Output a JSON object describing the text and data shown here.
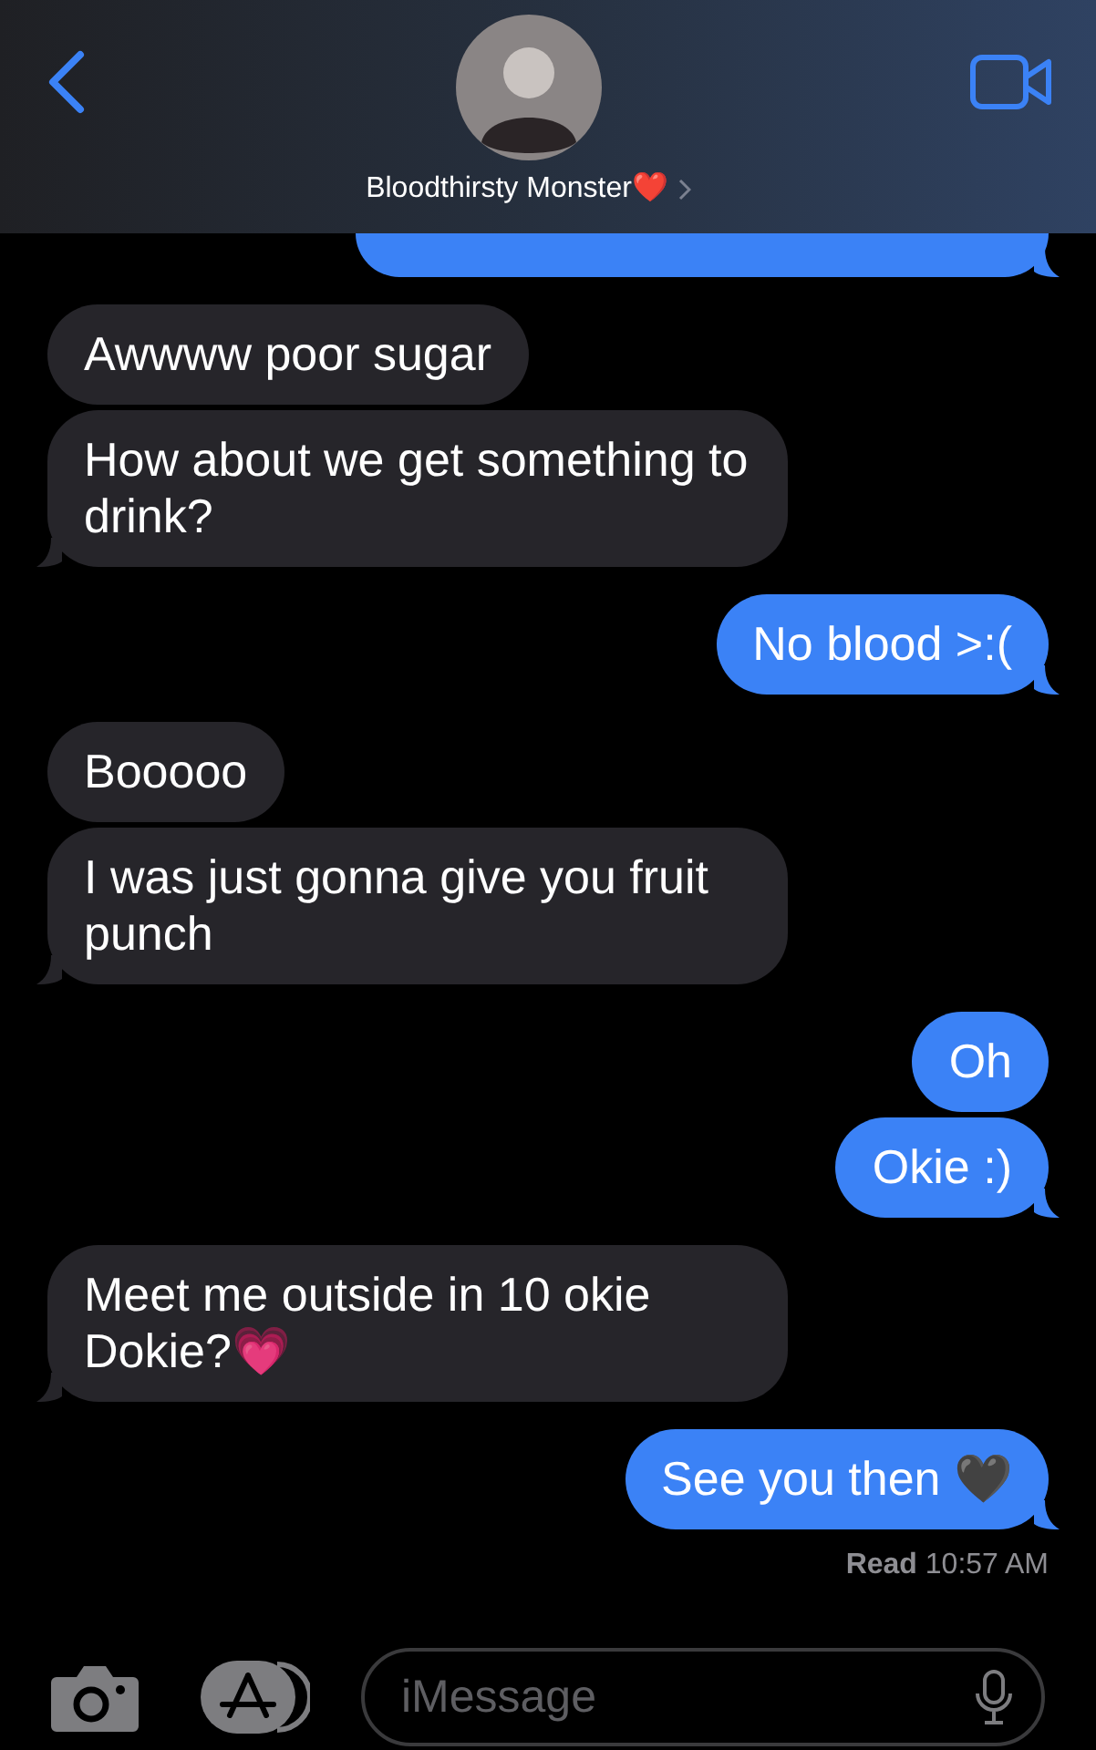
{
  "header": {
    "contact_name": "Bloodthirsty Monster❤️"
  },
  "messages": [
    {
      "kind": "received",
      "text": "Awwww poor sugar",
      "tail": false
    },
    {
      "kind": "received",
      "text": "How about we get something to drink?",
      "tail": true
    },
    {
      "kind": "sent",
      "text": "No blood >:(",
      "tail": true
    },
    {
      "kind": "received",
      "text": "Booooo",
      "tail": false
    },
    {
      "kind": "received",
      "text": "I was just gonna give you fruit punch",
      "tail": true
    },
    {
      "kind": "sent",
      "text": "Oh",
      "tail": false
    },
    {
      "kind": "sent",
      "text": "Okie :)",
      "tail": true
    },
    {
      "kind": "received",
      "text": "Meet me outside in 10 okie Dokie?💗",
      "tail": true
    },
    {
      "kind": "sent",
      "text": "See you then 🖤",
      "tail": true
    }
  ],
  "read_receipt": "**Read** 10:57 AM",
  "composer": {
    "placeholder": "iMessage"
  }
}
